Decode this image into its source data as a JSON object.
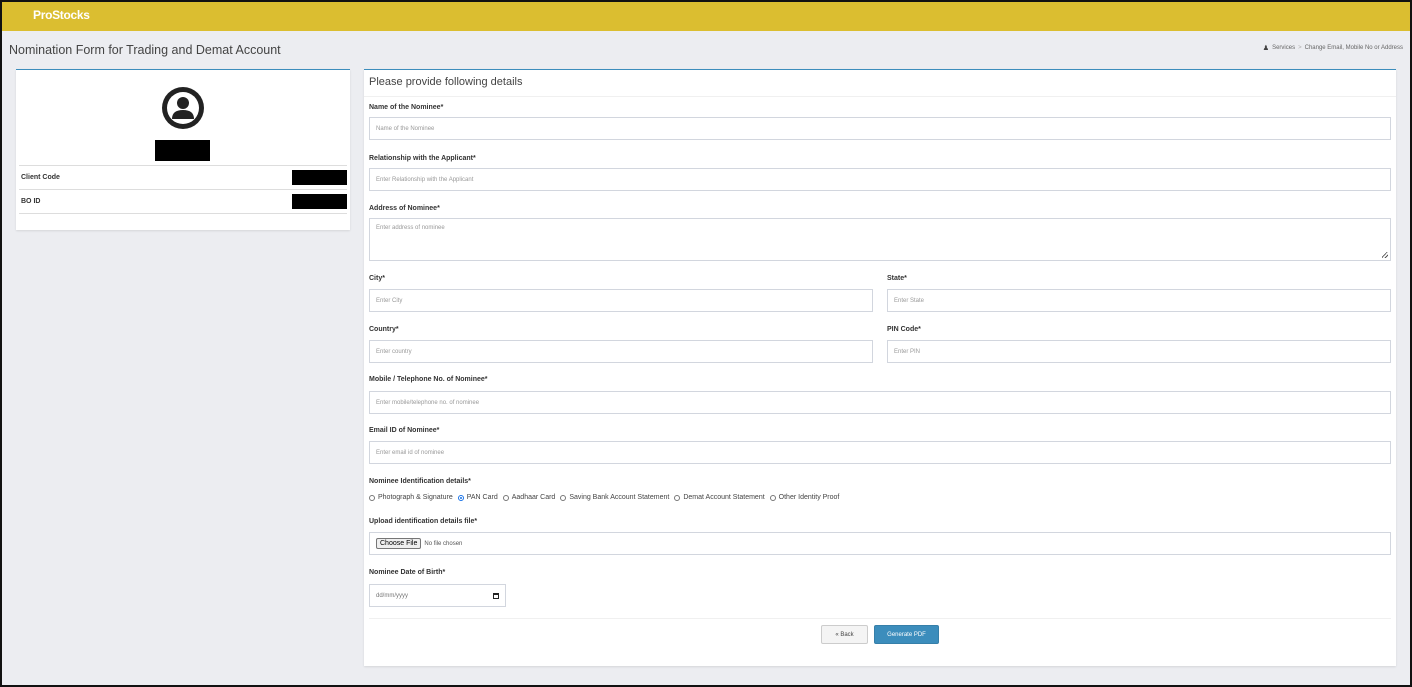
{
  "app": {
    "brand": "ProStocks"
  },
  "header": {
    "title": "Nomination Form for Trading and Demat Account",
    "breadcrumb": [
      "Services",
      "Change Email, Mobile No or Address"
    ]
  },
  "profile": {
    "client_code_label": "Client Code",
    "bo_id_label": "BO ID"
  },
  "form": {
    "heading": "Please provide following details",
    "fields": {
      "nominee_name": {
        "label": "Name of the Nominee*",
        "placeholder": "Name of the Nominee",
        "value": ""
      },
      "relationship": {
        "label": "Relationship with the Applicant*",
        "placeholder": "Enter Relationship with the Applicant",
        "value": ""
      },
      "address": {
        "label": "Address of Nominee*",
        "placeholder": "Enter address of nominee",
        "value": ""
      },
      "city": {
        "label": "City*",
        "placeholder": "Enter City",
        "value": ""
      },
      "state": {
        "label": "State*",
        "placeholder": "Enter State",
        "value": ""
      },
      "country": {
        "label": "Country*",
        "placeholder": "Enter country",
        "value": ""
      },
      "pin": {
        "label": "PIN Code*",
        "placeholder": "Enter PIN",
        "value": ""
      },
      "mobile": {
        "label": "Mobile / Telephone No. of Nominee*",
        "placeholder": "Enter mobile/telephone no. of nominee",
        "value": ""
      },
      "email": {
        "label": "Email ID of Nominee*",
        "placeholder": "Enter email id of nominee",
        "value": ""
      }
    },
    "identification": {
      "label": "Nominee Identification details*",
      "options": [
        "Photograph & Signature",
        "PAN Card",
        "Aadhaar Card",
        "Saving Bank Account Statement",
        "Demat Account Statement",
        "Other Identity Proof"
      ],
      "selected": "PAN Card"
    },
    "upload": {
      "label": "Upload identification details file*",
      "button": "Choose File",
      "status": "No file chosen"
    },
    "dob": {
      "label": "Nominee Date of Birth*",
      "placeholder": "dd/mm/yyyy"
    },
    "buttons": {
      "back": "« Back",
      "generate": "Generate PDF"
    }
  },
  "colors": {
    "topbar": "#dbbe30",
    "primary": "#3c8dbc",
    "background": "#ecedf1"
  }
}
